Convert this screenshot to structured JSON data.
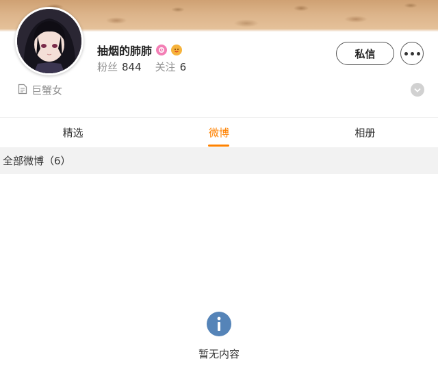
{
  "profile": {
    "name": "抽烟的肺肺",
    "followers_label": "粉丝",
    "followers_count": "844",
    "following_label": "关注",
    "following_count": "6",
    "bio": "巨蟹女",
    "badges": [
      "pink-badge-icon",
      "emoji-face-icon"
    ]
  },
  "actions": {
    "message_label": "私信",
    "more_icon": "more-dots-icon"
  },
  "tabs": [
    {
      "label": "精选",
      "active": false
    },
    {
      "label": "微博",
      "active": true
    },
    {
      "label": "相册",
      "active": false
    }
  ],
  "feed": {
    "section_title": "全部微博（6）",
    "empty_text": "暂无内容",
    "empty_icon": "info-icon"
  },
  "colors": {
    "accent": "#ff8200",
    "info_icon": "#5584b8",
    "pink_badge": "#f37fb5"
  }
}
